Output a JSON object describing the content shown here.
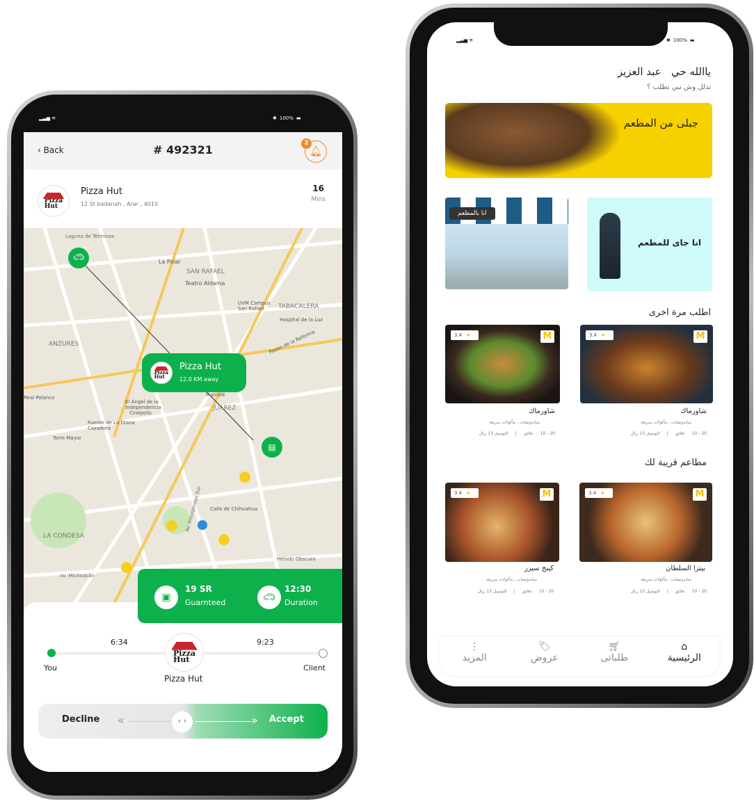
{
  "left": {
    "status": {
      "battery": "100%"
    },
    "header": {
      "back": "Back",
      "order": "# 492321",
      "notifications": "2"
    },
    "restaurant": {
      "name": "Pizza Hut",
      "address": "12 St badanah , Arar , 4010",
      "eta_value": "16",
      "eta_unit": "Mins",
      "logo_text": "Pizza Hut"
    },
    "map": {
      "labels": [
        "Laguna de Términos",
        "SAN RAFAEL",
        "Teatro Aldama",
        "La Polar",
        "UVM Campus San Rafael",
        "TABACALERA",
        "Hospital de la Luz",
        "ANZURES",
        "Cinépolis",
        "El Ángel de la Independencia",
        "JUÁREZ",
        "Marriott",
        "Torre Mayor",
        "Fuente de La Diana Cazadora",
        "LA CONDESA",
        "Av. Michoacán",
        "Helado Obscuro",
        "Real Polanco",
        "Av. Insurgentes Sur",
        "Calle de Chihuahua",
        "Paseo de la Reforma"
      ],
      "pin": {
        "name": "Pizza Hut",
        "distance": "12.0 KM away"
      }
    },
    "info": {
      "price": "19 SR",
      "price_label": "Guarnteed",
      "duration": "12:30",
      "duration_label": "Duration"
    },
    "progress": {
      "start": "You",
      "end": "Client",
      "mid": "Pizza Hut",
      "time1": "6:34",
      "time2": "9:23"
    },
    "swipe": {
      "decline": "Decline",
      "accept": "Accept"
    },
    "colors": {
      "green": "#0db14b",
      "orange": "#f08a24"
    }
  },
  "right": {
    "status": {
      "battery": "100%"
    },
    "greeting": {
      "name": "عبد العزيز",
      "hello": "ياالله حي",
      "sub": "تدلل وش تبي تطلب ؟"
    },
    "banner": "جبلى من المطعم",
    "dine_in": "انا بالمطعم",
    "coming": "انا جاى للمطعم",
    "sections": {
      "reorder": "اطلب مرة اخرى",
      "nearby": "مطاعم قريبة لك"
    },
    "cards": [
      {
        "name": "شاورماك",
        "tags": "ساندوتشات , مأكولات سريعة",
        "time": "20 - 10",
        "unit": "دقائق",
        "delivery": "التوصيل 13 ريال",
        "rating": "3.4",
        "logo": "M"
      },
      {
        "name": "شاورماك",
        "tags": "ساندوتشات , مأكولات سريعة",
        "time": "20 - 10",
        "unit": "دقائق",
        "delivery": "التوصيل 13 ريال",
        "rating": "3.4",
        "logo": "M"
      },
      {
        "name": "بيتزا السلطان",
        "tags": "ساندوتشات , مأكولات سريعة",
        "time": "20 - 10",
        "unit": "دقائق",
        "delivery": "التوصيل 13 ريال",
        "rating": "3.4",
        "logo": "M"
      },
      {
        "name": "كينج سيزر",
        "tags": "ساندوتشات , مأكولات سريعة",
        "time": "20 - 10",
        "unit": "دقائق",
        "delivery": "التوصيل 13 ريال",
        "rating": "3.4",
        "logo": "M"
      }
    ],
    "nav": [
      {
        "label": "الرئيسية",
        "icon": "home-icon"
      },
      {
        "label": "طلباتى",
        "icon": "cart-icon"
      },
      {
        "label": "عروض",
        "icon": "tag-icon"
      },
      {
        "label": "المزيد",
        "icon": "more-icon"
      }
    ],
    "colors": {
      "banner": "#f7d000",
      "coming": "#cffcfb"
    }
  }
}
